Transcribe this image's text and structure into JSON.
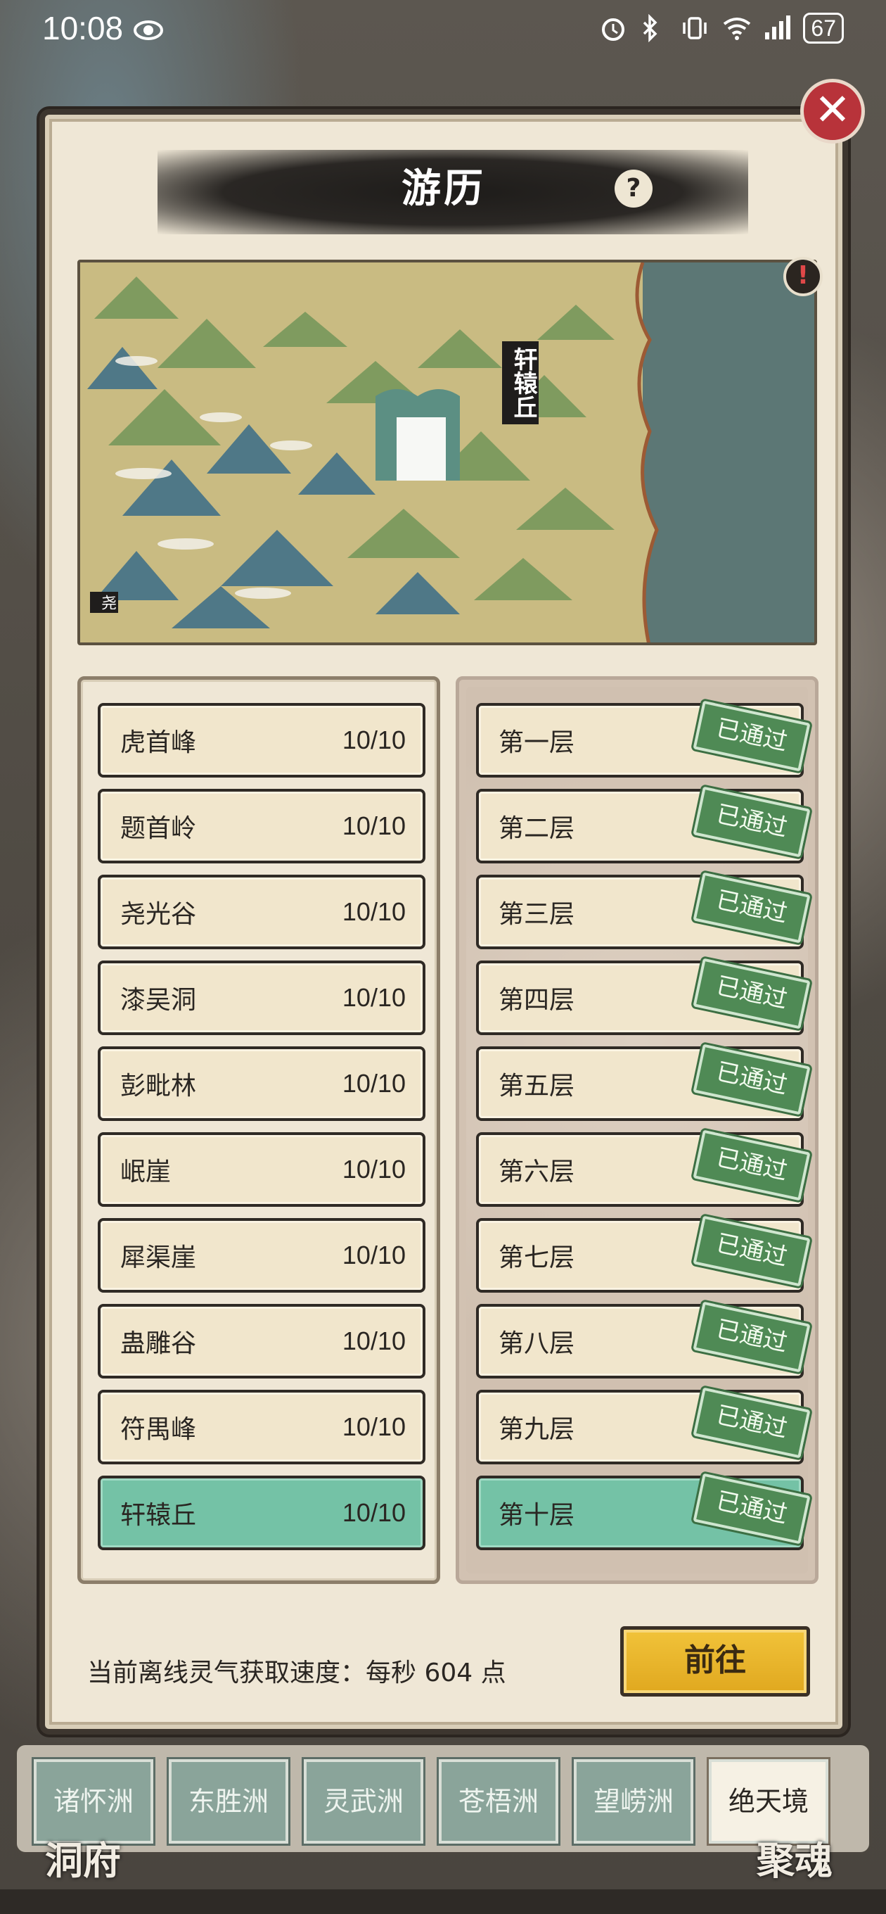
{
  "status_bar": {
    "time": "10:08",
    "battery": "67",
    "icons": [
      "eye-icon",
      "alarm-icon",
      "bluetooth-icon",
      "vibrate-icon",
      "wifi-icon",
      "signal-icon"
    ]
  },
  "dialog": {
    "title": "游历",
    "help_label": "?",
    "close_label": "✕",
    "map": {
      "current_location": "轩辕丘",
      "corner_location": "尧",
      "alert_label": "!"
    },
    "locations": [
      {
        "name": "虎首峰",
        "progress": "10/10"
      },
      {
        "name": "题首岭",
        "progress": "10/10"
      },
      {
        "name": "尧光谷",
        "progress": "10/10"
      },
      {
        "name": "漆吴洞",
        "progress": "10/10"
      },
      {
        "name": "彭毗林",
        "progress": "10/10"
      },
      {
        "name": "岷崖",
        "progress": "10/10"
      },
      {
        "name": "犀渠崖",
        "progress": "10/10"
      },
      {
        "name": "蛊雕谷",
        "progress": "10/10"
      },
      {
        "name": "符禺峰",
        "progress": "10/10"
      },
      {
        "name": "轩辕丘",
        "progress": "10/10",
        "selected": true
      }
    ],
    "floors": [
      {
        "name": "第一层",
        "status": "已通过"
      },
      {
        "name": "第二层",
        "status": "已通过"
      },
      {
        "name": "第三层",
        "status": "已通过"
      },
      {
        "name": "第四层",
        "status": "已通过"
      },
      {
        "name": "第五层",
        "status": "已通过"
      },
      {
        "name": "第六层",
        "status": "已通过"
      },
      {
        "name": "第七层",
        "status": "已通过"
      },
      {
        "name": "第八层",
        "status": "已通过"
      },
      {
        "name": "第九层",
        "status": "已通过"
      },
      {
        "name": "第十层",
        "status": "已通过",
        "selected": true
      }
    ],
    "offline_speed_text": "当前离线灵气获取速度：每秒 604 点",
    "go_button": "前往"
  },
  "region_tabs": [
    "诸怀洲",
    "东胜洲",
    "灵武洲",
    "苍梧洲",
    "望崂洲",
    "绝天境"
  ],
  "active_tab": "绝天境",
  "background_labels": {
    "left": "洞府",
    "right": "聚魂"
  },
  "colors": {
    "selected_row": "#74c2a6",
    "stamp_green": "#4f8a55",
    "go_button": "#e8b52a",
    "close_button": "#b8333a"
  }
}
